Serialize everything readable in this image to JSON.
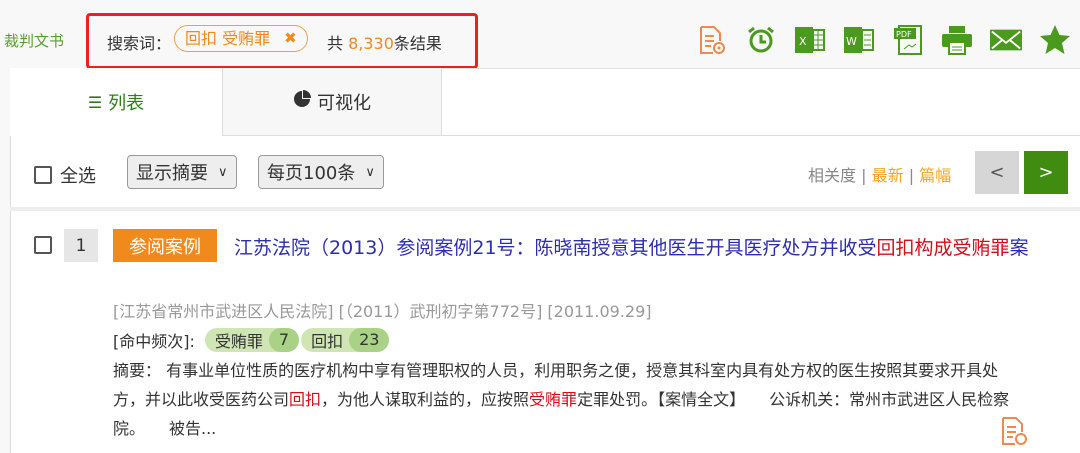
{
  "breadcrumb": "裁判文书",
  "search": {
    "label": "搜索词：",
    "tag": "回扣 受贿罪",
    "remove": "✖",
    "count_prefix": "共 ",
    "count": "8,330",
    "count_suffix": "条结果"
  },
  "toolbar_icons": [
    "report-icon",
    "alarm-icon",
    "excel-icon",
    "word-icon",
    "pdf-icon",
    "print-icon",
    "mail-icon",
    "star-icon"
  ],
  "tabs": [
    {
      "label": "列表",
      "icon": "list-icon"
    },
    {
      "label": "可视化",
      "icon": "pie-chart-icon"
    }
  ],
  "controls": {
    "select_all": "全选",
    "display": "显示摘要",
    "per_page": "每页100条",
    "sort": [
      "相关度",
      "最新",
      "篇幅"
    ],
    "sep": "|",
    "prev": "<",
    "next": ">"
  },
  "result": {
    "index": "1",
    "badge": "参阅案例",
    "title": "江苏法院（2013）参阅案例21号：陈晓南授意其他医生开具医疗处方并收受",
    "title_hl": "回扣构成受贿罪",
    "title_end": "案",
    "court": "[江苏省常州市武进区人民法院] [（2011）武刑初字第772号] [2011.09.29]",
    "hits_label": "[命中频次]:",
    "hits": [
      {
        "term": "受贿罪",
        "count": "7"
      },
      {
        "term": "回扣",
        "count": "23"
      }
    ],
    "abstract": [
      "摘要：  有事业单位性质的医疗机构中享有管理职权的人员，利用职务之便，授意其科室内具有处方权的医生按照其要求开具处方，并以此收受医药公司",
      "回扣",
      "，为他人谋取利益的，应按照",
      "受贿罪",
      "定罪处罚。【案情全文】　　公诉机关：常州市武进区人民检察院。　　被告..."
    ]
  },
  "colors": {
    "green": "#3f8c10",
    "orange": "#f08a1c",
    "red": "#e8231f"
  }
}
